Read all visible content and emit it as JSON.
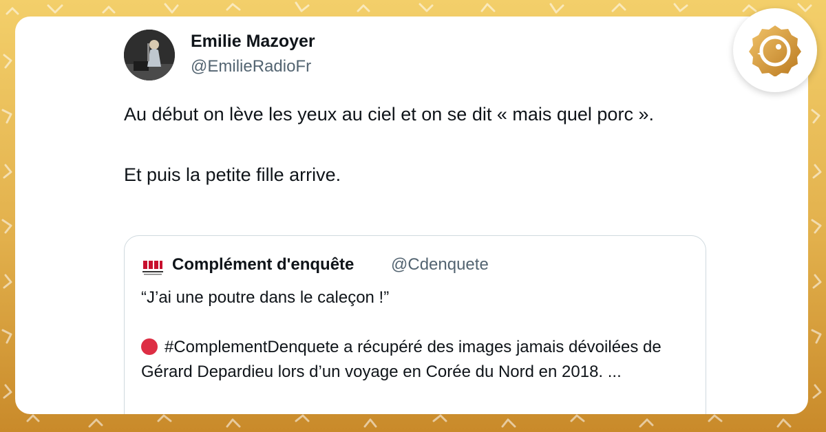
{
  "tweet": {
    "author_name": "Emilie Mazoyer",
    "author_handle": "@EmilieRadioFr",
    "paragraphs": [
      "Au début on lève les yeux au ciel et on se dit « mais quel porc ».",
      "Et puis la petite fille arrive."
    ]
  },
  "quoted_tweet": {
    "author_name": "Complément d'enquête",
    "author_handle": "@Cdenquete",
    "line1": "“J’ai une poutre dans le caleçon !”",
    "line2": "#ComplementDenquete a récupéré des images jamais dévoilées de Gérard Depardieu lors d’un voyage en Corée du Nord en 2018. ...",
    "red_dot_color": "#dd2e44"
  },
  "colors": {
    "background": "#e2b04c",
    "card": "#ffffff",
    "text_primary": "#0f1419",
    "text_secondary": "#536471",
    "badge_gold": "#c98a2a"
  },
  "icons": {
    "site_badge": "gold-chick-logo-icon",
    "avatar": "profile-photo",
    "quoted_logo": "complement-denquete-logo-icon",
    "red_circle": "red-circle-emoji"
  }
}
